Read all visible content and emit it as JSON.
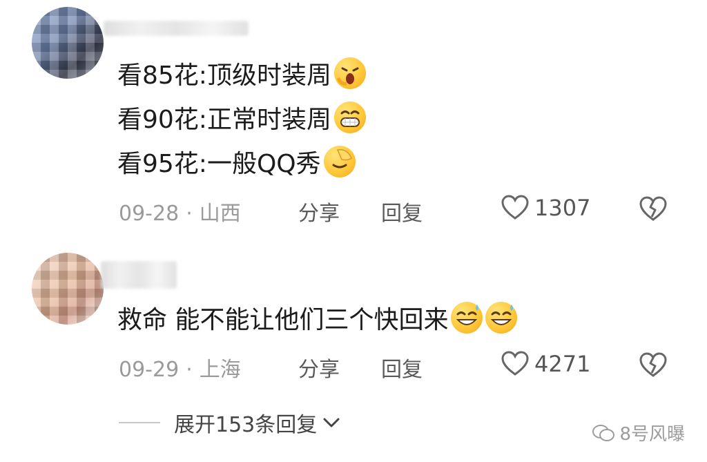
{
  "comments": [
    {
      "lines": [
        "看85花:顶级时装周",
        "看90花:正常时装周",
        "看95花:一般QQ秀"
      ],
      "line_emojis": [
        "shocked-emoji",
        "grin-emoji",
        "facepalm-emoji"
      ],
      "date": "09-28",
      "separator": "·",
      "location": "山西",
      "share_label": "分享",
      "reply_label": "回复",
      "like_count": "1307"
    },
    {
      "lines": [
        "救命 能不能让他们三个快回来"
      ],
      "line_emojis": [
        "laugh-sweat-emoji",
        "laugh-sweat-emoji"
      ],
      "date": "09-29",
      "separator": "·",
      "location": "上海",
      "share_label": "分享",
      "reply_label": "回复",
      "like_count": "4271"
    }
  ],
  "expand_replies": "展开153条回复",
  "watermark": "8号风曝",
  "colors": {
    "meta": "#9a9a9a",
    "text": "#1b1b1b",
    "emoji": "#ffc83a"
  }
}
